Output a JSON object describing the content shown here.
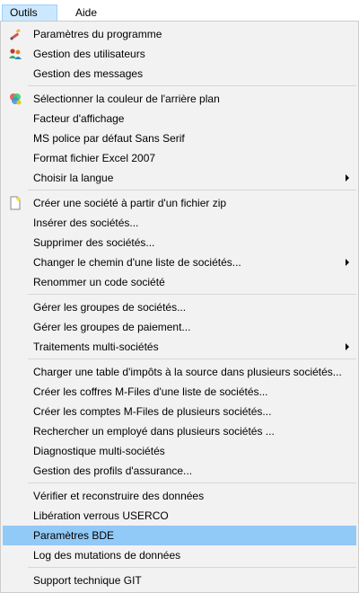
{
  "menubar": {
    "items": [
      {
        "label": "Outils",
        "active": true
      },
      {
        "label": "Aide",
        "active": false
      }
    ]
  },
  "menu": {
    "groups": [
      [
        {
          "label": "Paramètres du programme",
          "icon": "settings-wand-icon"
        },
        {
          "label": "Gestion des utilisateurs",
          "icon": "users-icon"
        },
        {
          "label": "Gestion des messages"
        }
      ],
      [
        {
          "label": "Sélectionner la couleur de l'arrière plan",
          "icon": "color-palette-icon"
        },
        {
          "label": "Facteur d'affichage"
        },
        {
          "label": "MS police par défaut Sans Serif"
        },
        {
          "label": "Format fichier Excel 2007"
        },
        {
          "label": "Choisir la langue",
          "submenu": true
        }
      ],
      [
        {
          "label": "Créer une société à partir d'un fichier zip",
          "icon": "new-document-icon"
        },
        {
          "label": "Insérer des sociétés..."
        },
        {
          "label": "Supprimer des sociétés..."
        },
        {
          "label": "Changer le chemin d'une liste de sociétés...",
          "submenu": true
        },
        {
          "label": "Renommer un code société"
        }
      ],
      [
        {
          "label": "Gérer les groupes de sociétés..."
        },
        {
          "label": "Gérer les groupes de paiement..."
        },
        {
          "label": "Traitements multi-sociétés",
          "submenu": true
        }
      ],
      [
        {
          "label": "Charger une table d'impôts à la source dans plusieurs sociétés..."
        },
        {
          "label": "Créer les coffres M-Files d'une liste de sociétés..."
        },
        {
          "label": "Créer les comptes M-Files de plusieurs sociétés..."
        },
        {
          "label": "Rechercher un employé dans plusieurs sociétés ..."
        },
        {
          "label": "Diagnostique multi-sociétés"
        },
        {
          "label": "Gestion des profils d'assurance..."
        }
      ],
      [
        {
          "label": "Vérifier et reconstruire des données"
        },
        {
          "label": "Libération verrous USERCO"
        },
        {
          "label": "Paramètres BDE",
          "highlighted": true
        },
        {
          "label": "Log des mutations de données"
        }
      ],
      [
        {
          "label": "Support technique GIT"
        }
      ]
    ]
  },
  "colors": {
    "menu_background": "#f2f2f2",
    "highlight": "#91c9f7",
    "menubar_active": "#cce8ff"
  }
}
